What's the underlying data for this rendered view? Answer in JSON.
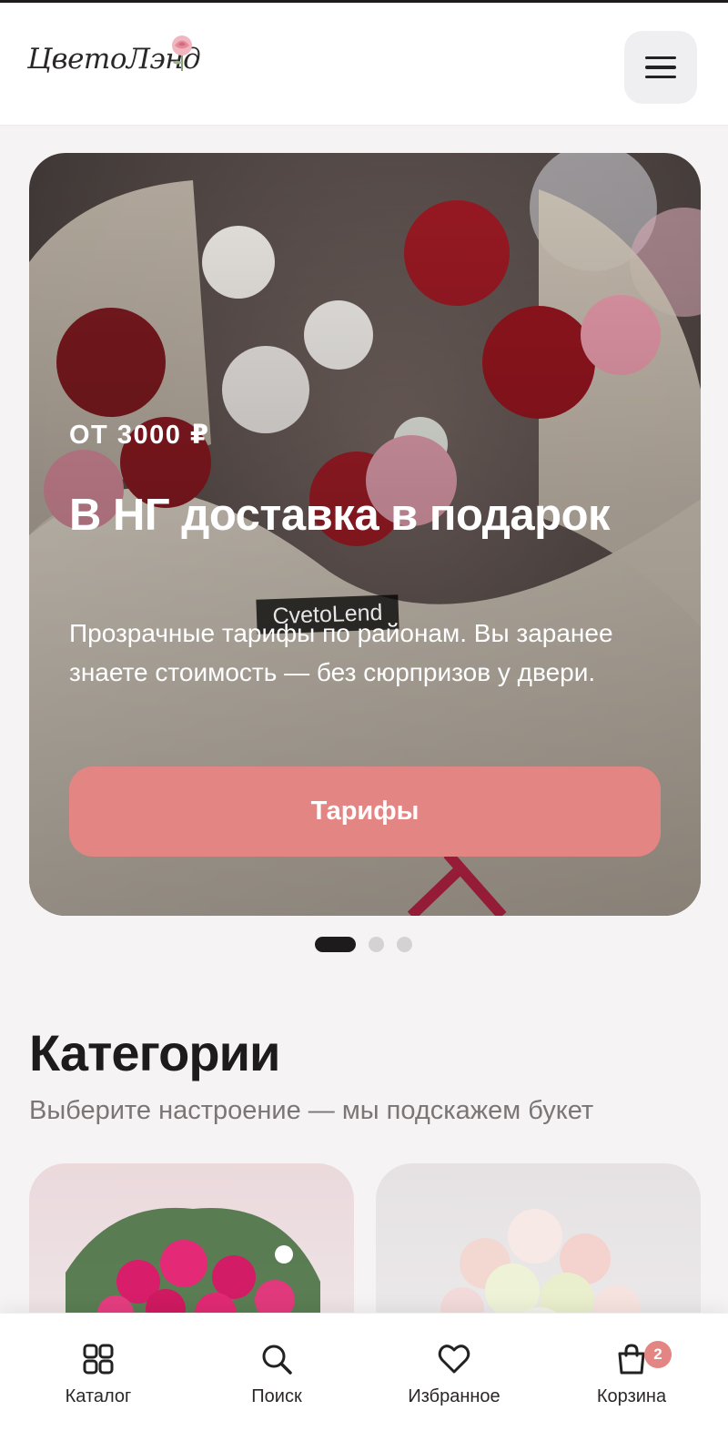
{
  "header": {
    "logo_text": "ЦветоЛэнд",
    "menu_icon": "hamburger-menu-icon"
  },
  "hero": {
    "price": "ОТ 3000 ₽",
    "title": "В НГ доставка в подарок",
    "description": "Прозрачные тарифы по районам. Вы заранее знаете стоимость — без сюрпризов у двери.",
    "button_label": "Тарифы",
    "watermark": "CvetoLend",
    "slides_total": 3,
    "active_slide": 1
  },
  "categories": {
    "title": "Категории",
    "subtitle": "Выберите настроение — мы подскажем букет"
  },
  "bottom_nav": {
    "items": [
      {
        "label": "Каталог",
        "icon": "grid-icon"
      },
      {
        "label": "Поиск",
        "icon": "search-icon"
      },
      {
        "label": "Избранное",
        "icon": "heart-icon"
      },
      {
        "label": "Корзина",
        "icon": "shopping-bag-icon"
      }
    ],
    "cart_count": "2"
  },
  "colors": {
    "accent": "#e38582",
    "text": "#1d1b1c",
    "muted": "#7b7576",
    "background": "#f6f3f4"
  }
}
